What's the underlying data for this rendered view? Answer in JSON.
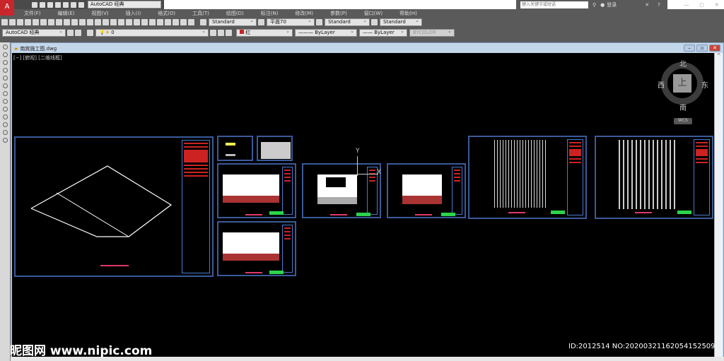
{
  "app": {
    "workspace": "AutoCAD 经典",
    "search_placeholder": "键入关键字或短语",
    "login": "登录"
  },
  "menu": [
    "文件(F)",
    "编辑(E)",
    "视图(V)",
    "插入(I)",
    "格式(O)",
    "工具(T)",
    "绘图(D)",
    "标注(N)",
    "修改(M)",
    "参数(P)",
    "窗口(W)",
    "帮助(H)"
  ],
  "toolbar1": {
    "text_style": "Standard",
    "dim_style": "平面70",
    "table_style": "Standard",
    "mleader_style": "Standard"
  },
  "toolbar2": {
    "workspace": "AutoCAD 经典",
    "layer": "0",
    "color": "红",
    "linetype": "ByLayer",
    "lineweight": "ByLayer",
    "plotstyle": "BYCOLOR"
  },
  "document": {
    "title": "南宾施工图.dwg",
    "view_label": "[−] [俯视] [二维线框]"
  },
  "viewcube": {
    "north": "北",
    "south": "南",
    "east": "东",
    "west": "西",
    "top": "上",
    "wcs": "WCS"
  },
  "ucs": {
    "x": "X",
    "y": "Y"
  },
  "colors": {
    "canvas": "#000000",
    "frame": "#3a5a9a",
    "accent_red": "#c8262a"
  },
  "watermark": "昵图网 www.nipic.com",
  "image_id": "ID:2012514 NO:20200321162054152509"
}
